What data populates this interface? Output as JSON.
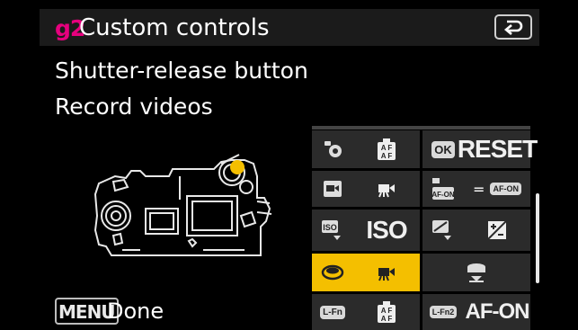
{
  "header": {
    "menu_code": "g2",
    "title": "Custom controls",
    "back_icon": "return-icon"
  },
  "subtitles": [
    "Shutter-release button",
    "Record videos"
  ],
  "footer": {
    "menu_key": "MENU",
    "done_label": "Done"
  },
  "grid": {
    "rows": [
      {
        "left": {
          "icon": "shutter-af-icon",
          "value_icon": "af-mode-icon"
        },
        "right": {
          "badge": "OK",
          "value": "RESET"
        }
      },
      {
        "left": {
          "icon": "video-record-button-icon",
          "value_icon": "movie-camera-icon"
        },
        "right": {
          "icon": "af-on-lock-icon",
          "eq": "=",
          "chip": "AF-ON"
        }
      },
      {
        "left": {
          "icon": "iso-button-icon",
          "value": "ISO"
        },
        "right": {
          "icon": "exposure-comp-button-icon",
          "value_icon": "exposure-comp-icon"
        }
      },
      {
        "left": {
          "icon": "shutter-release-button-icon",
          "value_icon": "movie-camera-icon",
          "selected": true
        },
        "right": {
          "value_icon": "sub-selector-center-icon"
        }
      },
      {
        "left": {
          "badge": "L-Fn",
          "value_icon": "af-mode-icon"
        },
        "right": {
          "badge": "L-Fn2",
          "value": "AF-ON"
        }
      }
    ]
  },
  "colors": {
    "accent": "#e6007e",
    "selected": "#f4bf00",
    "cell": "#2b2b2b",
    "header": "#1b1b1b"
  }
}
